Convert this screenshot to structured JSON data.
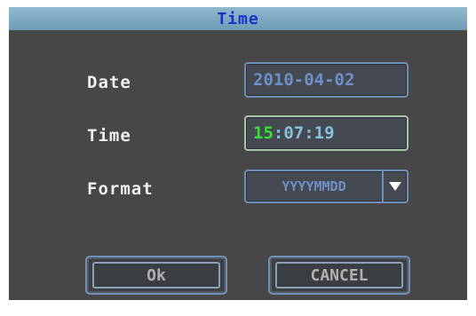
{
  "dialog": {
    "title": "Time"
  },
  "rows": {
    "date": {
      "label": "Date",
      "value": "2010-04-02"
    },
    "time": {
      "label": "Time",
      "hour": "15",
      "separator": ":",
      "rest": "07:19"
    },
    "format": {
      "label": "Format",
      "value": "YYYYMMDD",
      "dropdown_icon": "triangle-down-icon"
    }
  },
  "buttons": {
    "ok_label": "Ok",
    "cancel_label": "CANCEL"
  },
  "colors": {
    "background": "#474747",
    "titlebar": "#7fa9c2",
    "title_text": "#1a30c8",
    "field_border": "#6e8fb8",
    "hour_highlight": "#33e233"
  }
}
